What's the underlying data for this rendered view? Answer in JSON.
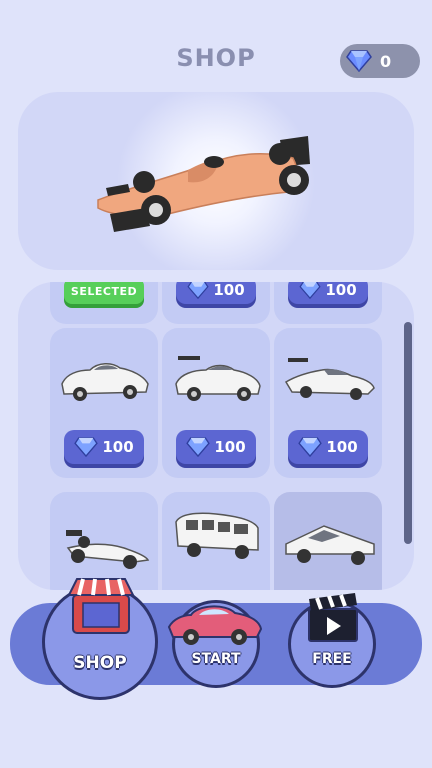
{
  "header": {
    "title": "SHOP",
    "gem_count": "0"
  },
  "shop": {
    "top_row": [
      {
        "label": "SELECTED",
        "kind": "selected"
      },
      {
        "label": "100",
        "kind": "price"
      },
      {
        "label": "100",
        "kind": "price"
      }
    ],
    "middle_row": [
      {
        "car": "white-sedan",
        "price": "100"
      },
      {
        "car": "white-sports-car",
        "price": "100"
      },
      {
        "car": "white-supercar",
        "price": "100"
      }
    ],
    "bottom_row": [
      {
        "car": "white-formula-car"
      },
      {
        "car": "white-van"
      },
      {
        "car": "white-cybertruck"
      }
    ]
  },
  "nav": {
    "shop": "SHOP",
    "start": "START",
    "free": "FREE"
  },
  "colors": {
    "price_button": "#5c66d2",
    "selected_button": "#57cf5a",
    "bottom_bar": "#6b7bd6",
    "preview_car": "#f0a77f"
  }
}
